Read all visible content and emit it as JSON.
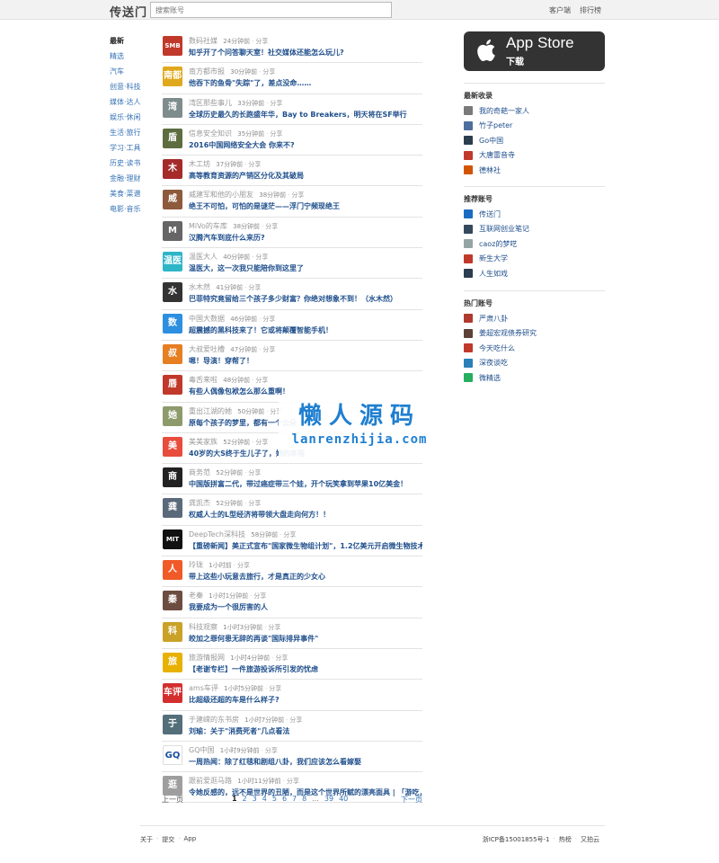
{
  "header": {
    "logo": "传送门",
    "search_placeholder": "搜索账号",
    "links": [
      "客户端",
      "排行榜"
    ]
  },
  "leftnav": [
    "最新",
    "精选",
    "汽车",
    "创意·科技",
    "媒体·达人",
    "娱乐·休闲",
    "生活·旅行",
    "学习·工具",
    "历史·读书",
    "金融·理财",
    "美食·菜谱",
    "电影·音乐"
  ],
  "feed": [
    {
      "source": "数码社媒",
      "time": "24分钟前",
      "share": "分享",
      "title": "知乎开了个问答聊天室！社交媒体还能怎么玩儿?",
      "color": "#c0392b",
      "avatar_text": "SMB"
    },
    {
      "source": "南方都市报",
      "time": "30分钟前",
      "share": "分享",
      "title": "他吞下的鱼骨\"失踪\"了，差点没命……",
      "color": "#e0a81c",
      "avatar_text": "南都"
    },
    {
      "source": "湾区那些事儿",
      "time": "33分钟前",
      "share": "分享",
      "title": "全球历史最久的长跑盛年华，Bay to Breakers，明天将在SF举行",
      "color": "#7f8c8d",
      "avatar_text": "湾"
    },
    {
      "source": "信息安全知识",
      "time": "35分钟前",
      "share": "分享",
      "title": "2016中国网络安全大会 你来不?",
      "color": "#5d6d3f",
      "avatar_text": "盾"
    },
    {
      "source": "木工坊",
      "time": "37分钟前",
      "share": "分享",
      "title": "高等教育资源的产销区分化及其破局",
      "color": "#a52a2a",
      "avatar_text": "木"
    },
    {
      "source": "威建军和他的小朋友",
      "time": "38分钟前",
      "share": "分享",
      "title": "绝王不可怕，可怕的是谜茫——浮门宁频现绝王",
      "color": "#8e5a3c",
      "avatar_text": "威"
    },
    {
      "source": "MiVo的车库",
      "time": "38分钟前",
      "share": "分享",
      "title": "汉腾汽车到底什么来历?",
      "color": "#666666",
      "avatar_text": "M"
    },
    {
      "source": "温医大人",
      "time": "40分钟前",
      "share": "分享",
      "title": "温医大，这一次我只能陪你到这里了",
      "color": "#2eb6c7",
      "avatar_text": "温医"
    },
    {
      "source": "水木然",
      "time": "41分钟前",
      "share": "分享",
      "title": "巴菲特究竟留给三个孩子多少财富？你绝对想象不到！（水木然）",
      "color": "#333333",
      "avatar_text": "水"
    },
    {
      "source": "中国大数据",
      "time": "46分钟前",
      "share": "分享",
      "title": "超震撼的黑科技来了！它或将颠覆智能手机！",
      "color": "#2c8fe0",
      "avatar_text": "数"
    },
    {
      "source": "大叔爱吐槽",
      "time": "47分钟前",
      "share": "分享",
      "title": "嗯！导演！穿帮了！",
      "color": "#e67e22",
      "avatar_text": "叔"
    },
    {
      "source": "毒舌来啦",
      "time": "48分钟前",
      "share": "分享",
      "title": "有些人偶像包袱怎么那么重啊！",
      "color": "#c0392b",
      "avatar_text": "唇"
    },
    {
      "source": "重出江湖的她",
      "time": "50分钟前",
      "share": "分享",
      "title": "原每个孩子的梦里，都有一个云朵",
      "color": "#8d9a6b",
      "avatar_text": "她"
    },
    {
      "source": "美美家族",
      "time": "52分钟前",
      "share": "分享",
      "title": "40岁的大S终于生儿子了，她的幸福",
      "color": "#e74c3c",
      "avatar_text": "美"
    },
    {
      "source": "商务范",
      "time": "52分钟前",
      "share": "分享",
      "title": "中国版拼富二代，带过癌症带三个娃，开个玩笑拿到苹果10亿美金！",
      "color": "#222222",
      "avatar_text": "商"
    },
    {
      "source": "龚凯杰",
      "time": "52分钟前",
      "share": "分享",
      "title": "权威人士的L型经济将带领大盘走向何方！！",
      "color": "#5b6a7a",
      "avatar_text": "龚"
    },
    {
      "source": "DeepTech深科技",
      "time": "58分钟前",
      "share": "分享",
      "title": "【重磅新闻】美正式宣布\"国家微生物组计划\"，1.2亿美元开启微生物技术时代",
      "color": "#111111",
      "avatar_text": "MIT"
    },
    {
      "source": "玲珑",
      "time": "1小时前",
      "share": "分享",
      "title": "带上这些小玩意去旅行，才是真正的少女心",
      "color": "#f05a28",
      "avatar_text": "人"
    },
    {
      "source": "老秦",
      "time": "1小时1分钟前",
      "share": "分享",
      "title": "我要成为一个很厉害的人",
      "color": "#6d4c41",
      "avatar_text": "秦"
    },
    {
      "source": "科技观察",
      "time": "1小时3分钟前",
      "share": "分享",
      "title": "皎加之罪何患无辞的再谈\"国际排异事件\"",
      "color": "#c9a227",
      "avatar_text": "科"
    },
    {
      "source": "旅游情报网",
      "time": "1小时4分钟前",
      "share": "分享",
      "title": "【老谢专栏】一件旅游投诉所引发的忧虑",
      "color": "#e8b100",
      "avatar_text": "旅"
    },
    {
      "source": "ams车评",
      "time": "1小时5分钟前",
      "share": "分享",
      "title": "比超级还超的车是什么样子?",
      "color": "#d32f2f",
      "avatar_text": "车评"
    },
    {
      "source": "于建嵘的东书房",
      "time": "1小时7分钟前",
      "share": "分享",
      "title": "刘瑜：关于\"消费死者\"几点看法",
      "color": "#546e7a",
      "avatar_text": "于"
    },
    {
      "source": "GQ中国",
      "time": "1小时9分钟前",
      "share": "分享",
      "title": "一周热闻：除了红毯和剧组八卦，我们应该怎么看嫁娶",
      "color": "#ffffff",
      "avatar_text": "GQ"
    },
    {
      "source": "跟前爱逛马路",
      "time": "1小时11分钟前",
      "share": "分享",
      "title": "令她反感的，远不是世界的丑陋，而是这个世界所赋的漂亮面具 | 「游吃，去逛！」",
      "color": "#9e9e9e",
      "avatar_text": "逛"
    }
  ],
  "pager": {
    "prev": "上一页",
    "pages": [
      "1",
      "2",
      "3",
      "4",
      "5",
      "6",
      "7",
      "8"
    ],
    "ellipsis": "...",
    "tail": [
      "39",
      "40"
    ],
    "next": "下一页"
  },
  "watermark": {
    "cn": "懒人源码",
    "en": "lanrenzhijia.com"
  },
  "appstore": {
    "title": "App Store",
    "sub": "下载"
  },
  "latest_fav": {
    "heading": "最新收录",
    "items": [
      {
        "label": "我的奇葩一家人",
        "color": "#7a7a7a"
      },
      {
        "label": "竹子peter",
        "color": "#4e6e9e"
      },
      {
        "label": "Go中国",
        "color": "#2c3e50"
      },
      {
        "label": "大唐雷音寺",
        "color": "#c0392b"
      },
      {
        "label": "德林社",
        "color": "#d35400"
      }
    ]
  },
  "recommended": {
    "heading": "推荐账号",
    "items": [
      {
        "label": "传送门",
        "color": "#1a6cc2"
      },
      {
        "label": "互联网创业笔记",
        "color": "#34495e"
      },
      {
        "label": "caoz的梦呓",
        "color": "#95a5a6"
      },
      {
        "label": "新生大学",
        "color": "#c0392b"
      },
      {
        "label": "人生如戏",
        "color": "#2c3e50"
      }
    ]
  },
  "hot": {
    "heading": "热门账号",
    "items": [
      {
        "label": "严肃八卦",
        "color": "#b03a2e"
      },
      {
        "label": "姜超宏观债券研究",
        "color": "#5d4037"
      },
      {
        "label": "今天吃什么",
        "color": "#c0392b"
      },
      {
        "label": "深夜谈吃",
        "color": "#2980b9"
      },
      {
        "label": "微精选",
        "color": "#27ae60"
      }
    ]
  },
  "footer": {
    "left": [
      "关于",
      "提交",
      "App"
    ],
    "right": [
      "浙ICP备15001855号-1",
      "热榜",
      "又拍云"
    ],
    "sep": "·"
  }
}
